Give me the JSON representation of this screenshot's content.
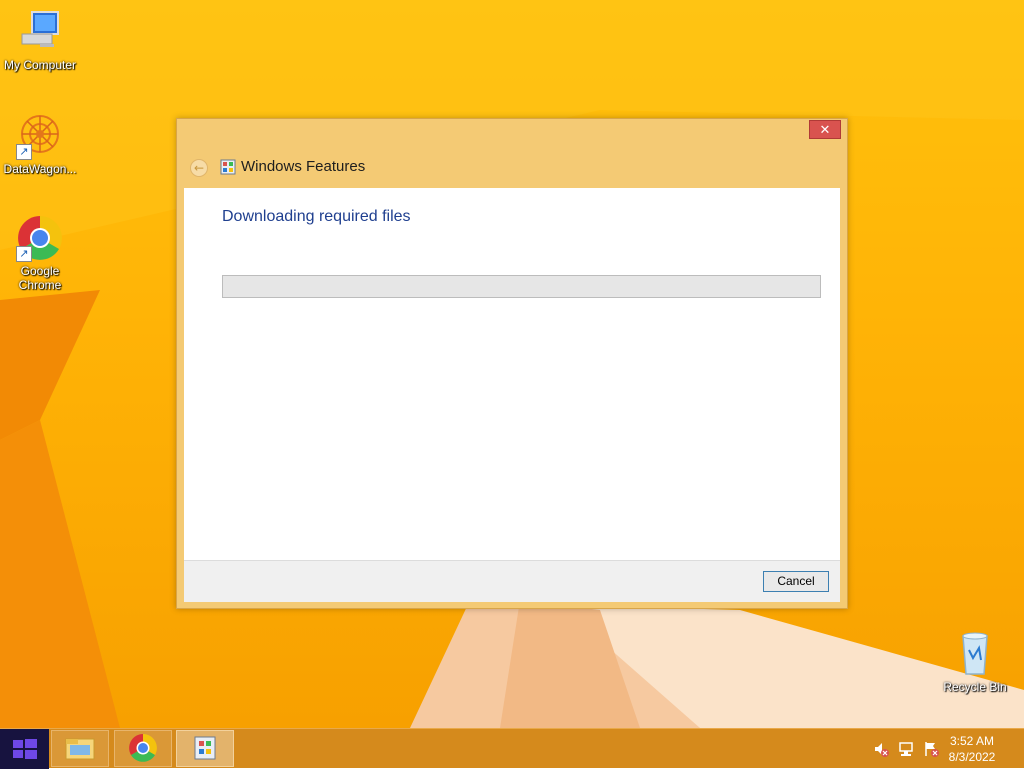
{
  "desktop": {
    "icons": [
      {
        "label": "My Computer",
        "icon": "computer-icon"
      },
      {
        "label": "DataWagon...",
        "icon": "datawagon-icon"
      },
      {
        "label": "Google Chrome",
        "icon": "chrome-icon"
      },
      {
        "label": "Recycle Bin",
        "icon": "recycle-bin-icon"
      }
    ]
  },
  "dialog": {
    "title": "Windows Features",
    "close_label": "✕",
    "heading": "Downloading required files",
    "progress_value": 0,
    "cancel_label": "Cancel"
  },
  "taskbar": {
    "items": [
      "file-explorer-icon",
      "chrome-icon",
      "windows-features-icon"
    ],
    "active_item": "windows-features-icon",
    "tray": [
      "volume-muted-icon",
      "network-icon",
      "action-center-flag-icon"
    ],
    "clock": {
      "time": "3:52 AM",
      "date": "8/3/2022"
    }
  },
  "colors": {
    "desktop_bg": "#ffb306",
    "dialog_frame": "#f4ca74",
    "close_button": "#d9534f",
    "heading_text": "#1f3f8f",
    "start_button": "#17133f",
    "taskbar": "#d58a1c"
  }
}
